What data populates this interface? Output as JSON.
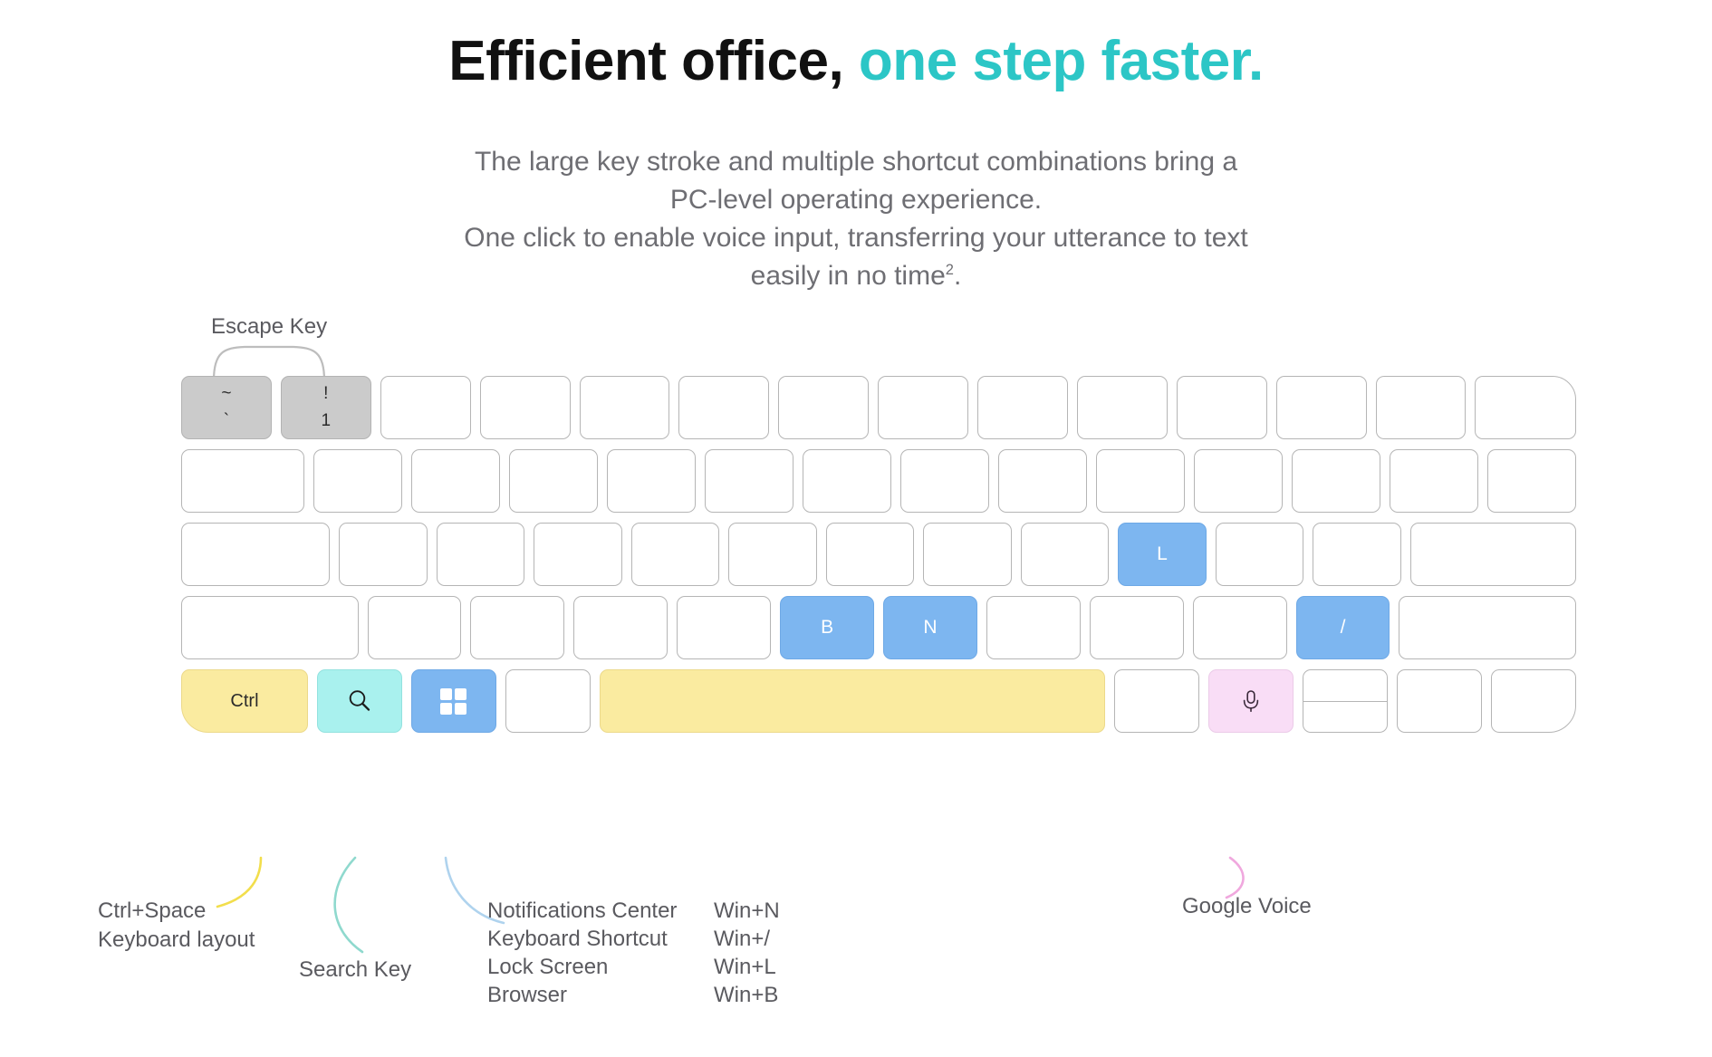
{
  "headline": {
    "part1": "Efficient office, ",
    "part2": "one step faster.",
    "accent_color": "#2CC6C6"
  },
  "subtitle": {
    "line1": "The large key stroke and multiple shortcut combinations bring a",
    "line2": "PC-level operating experience.",
    "line3": "One click to enable voice input, transferring your utterance to text",
    "line4_pre": "easily in no time",
    "line4_sup": "2",
    "line4_post": "."
  },
  "keyboard": {
    "row1": [
      {
        "name": "key-tilde",
        "top": "~",
        "bottom": "`",
        "style": "gray",
        "width": "w-1"
      },
      {
        "name": "key-1",
        "top": "!",
        "bottom": "1",
        "style": "gray",
        "width": "w-1"
      },
      {
        "name": "key-2",
        "label": "",
        "style": "plain",
        "width": "w-1"
      },
      {
        "name": "key-3",
        "label": "",
        "style": "plain",
        "width": "w-1"
      },
      {
        "name": "key-4",
        "label": "",
        "style": "plain",
        "width": "w-1"
      },
      {
        "name": "key-5",
        "label": "",
        "style": "plain",
        "width": "w-1"
      },
      {
        "name": "key-6",
        "label": "",
        "style": "plain",
        "width": "w-1"
      },
      {
        "name": "key-7",
        "label": "",
        "style": "plain",
        "width": "w-1"
      },
      {
        "name": "key-8",
        "label": "",
        "style": "plain",
        "width": "w-1"
      },
      {
        "name": "key-9",
        "label": "",
        "style": "plain",
        "width": "w-1"
      },
      {
        "name": "key-0",
        "label": "",
        "style": "plain",
        "width": "w-1"
      },
      {
        "name": "key-minus",
        "label": "",
        "style": "plain",
        "width": "w-1"
      },
      {
        "name": "key-equal",
        "label": "",
        "style": "plain",
        "width": "w-1"
      },
      {
        "name": "key-backspace",
        "label": "",
        "style": "plain",
        "width": "r1-last"
      }
    ],
    "row2": [
      {
        "name": "key-tab",
        "label": "",
        "style": "plain",
        "width": "w-14"
      },
      {
        "name": "key-q",
        "label": "",
        "style": "plain",
        "width": "w-1"
      },
      {
        "name": "key-w",
        "label": "",
        "style": "plain",
        "width": "w-1"
      },
      {
        "name": "key-e",
        "label": "",
        "style": "plain",
        "width": "w-1"
      },
      {
        "name": "key-r",
        "label": "",
        "style": "plain",
        "width": "w-1"
      },
      {
        "name": "key-t",
        "label": "",
        "style": "plain",
        "width": "w-1"
      },
      {
        "name": "key-y",
        "label": "",
        "style": "plain",
        "width": "w-1"
      },
      {
        "name": "key-u",
        "label": "",
        "style": "plain",
        "width": "w-1"
      },
      {
        "name": "key-i",
        "label": "",
        "style": "plain",
        "width": "w-1"
      },
      {
        "name": "key-o",
        "label": "",
        "style": "plain",
        "width": "w-1"
      },
      {
        "name": "key-p",
        "label": "",
        "style": "plain",
        "width": "w-1"
      },
      {
        "name": "key-bracket-left",
        "label": "",
        "style": "plain",
        "width": "w-1"
      },
      {
        "name": "key-bracket-right",
        "label": "",
        "style": "plain",
        "width": "w-1"
      },
      {
        "name": "key-backslash",
        "label": "",
        "style": "plain",
        "width": "w-1"
      }
    ],
    "row3": [
      {
        "name": "key-capslock",
        "label": "",
        "style": "plain",
        "width": "w-17"
      },
      {
        "name": "key-a",
        "label": "",
        "style": "plain",
        "width": "w-1"
      },
      {
        "name": "key-s",
        "label": "",
        "style": "plain",
        "width": "w-1"
      },
      {
        "name": "key-d",
        "label": "",
        "style": "plain",
        "width": "w-1"
      },
      {
        "name": "key-f",
        "label": "",
        "style": "plain",
        "width": "w-1"
      },
      {
        "name": "key-g",
        "label": "",
        "style": "plain",
        "width": "w-1"
      },
      {
        "name": "key-h",
        "label": "",
        "style": "plain",
        "width": "w-1"
      },
      {
        "name": "key-j",
        "label": "",
        "style": "plain",
        "width": "w-1"
      },
      {
        "name": "key-k",
        "label": "",
        "style": "plain",
        "width": "w-1"
      },
      {
        "name": "key-l",
        "label": "L",
        "style": "blue",
        "width": "w-1"
      },
      {
        "name": "key-semicolon",
        "label": "",
        "style": "plain",
        "width": "w-1"
      },
      {
        "name": "key-quote",
        "label": "",
        "style": "plain",
        "width": "w-1"
      },
      {
        "name": "key-enter",
        "label": "",
        "style": "plain",
        "width": "w-19"
      }
    ],
    "row4": [
      {
        "name": "key-shift-left",
        "label": "",
        "style": "plain",
        "width": "w-19"
      },
      {
        "name": "key-z",
        "label": "",
        "style": "plain",
        "width": "w-1"
      },
      {
        "name": "key-x",
        "label": "",
        "style": "plain",
        "width": "w-1"
      },
      {
        "name": "key-c",
        "label": "",
        "style": "plain",
        "width": "w-1"
      },
      {
        "name": "key-v",
        "label": "",
        "style": "plain",
        "width": "w-1"
      },
      {
        "name": "key-b",
        "label": "B",
        "style": "blue",
        "width": "w-1"
      },
      {
        "name": "key-n",
        "label": "N",
        "style": "blue",
        "width": "w-1"
      },
      {
        "name": "key-m",
        "label": "",
        "style": "plain",
        "width": "w-1"
      },
      {
        "name": "key-comma",
        "label": "",
        "style": "plain",
        "width": "w-1"
      },
      {
        "name": "key-period",
        "label": "",
        "style": "plain",
        "width": "w-1"
      },
      {
        "name": "key-slash",
        "label": "/",
        "style": "blue",
        "width": "w-1"
      },
      {
        "name": "key-shift-right",
        "label": "",
        "style": "plain",
        "width": "w-19"
      }
    ],
    "row5": [
      {
        "name": "key-ctrl",
        "label": "Ctrl",
        "style": "yellow",
        "width": "w-15",
        "corner": "r5-ctrl"
      },
      {
        "name": "key-search",
        "icon": "search-icon",
        "style": "cyan",
        "width": "w-1"
      },
      {
        "name": "key-launcher",
        "icon": "grid-icon",
        "style": "launcher",
        "width": "w-1"
      },
      {
        "name": "key-alt-left",
        "label": "",
        "style": "plain",
        "width": "w-1"
      },
      {
        "name": "key-space",
        "label": "",
        "style": "yellow",
        "width": "w-space"
      },
      {
        "name": "key-alt-right",
        "label": "",
        "style": "plain",
        "width": "w-1"
      },
      {
        "name": "key-voice",
        "icon": "mic-icon",
        "style": "pink",
        "width": "w-1"
      },
      {
        "name": "key-arrow-updown",
        "icon": "split-arrows",
        "style": "split",
        "width": "w-1"
      },
      {
        "name": "key-arrow-left",
        "label": "",
        "style": "plain",
        "width": "w-1"
      },
      {
        "name": "key-arrow-right",
        "label": "",
        "style": "plain",
        "width": "w-1",
        "corner": "r5-last"
      }
    ]
  },
  "annotations": {
    "escape_key": "Escape Key",
    "ctrl": "Ctrl+Space\nKeyboard layout",
    "search": "Search Key",
    "voice": "Google Voice"
  },
  "shortcuts": {
    "rows": [
      {
        "name": "Notifications Center",
        "combo": "Win+N"
      },
      {
        "name": "Keyboard Shortcut",
        "combo": "Win+/"
      },
      {
        "name": "Lock Screen",
        "combo": "Win+L"
      },
      {
        "name": "Browser",
        "combo": "Win+B"
      }
    ]
  },
  "connector_colors": {
    "escape": "#b9b9b9",
    "ctrl": "#F2DE4C",
    "search": "#8FD9CE",
    "launcher": "#AFD3EE",
    "voice": "#F0A8DE"
  }
}
